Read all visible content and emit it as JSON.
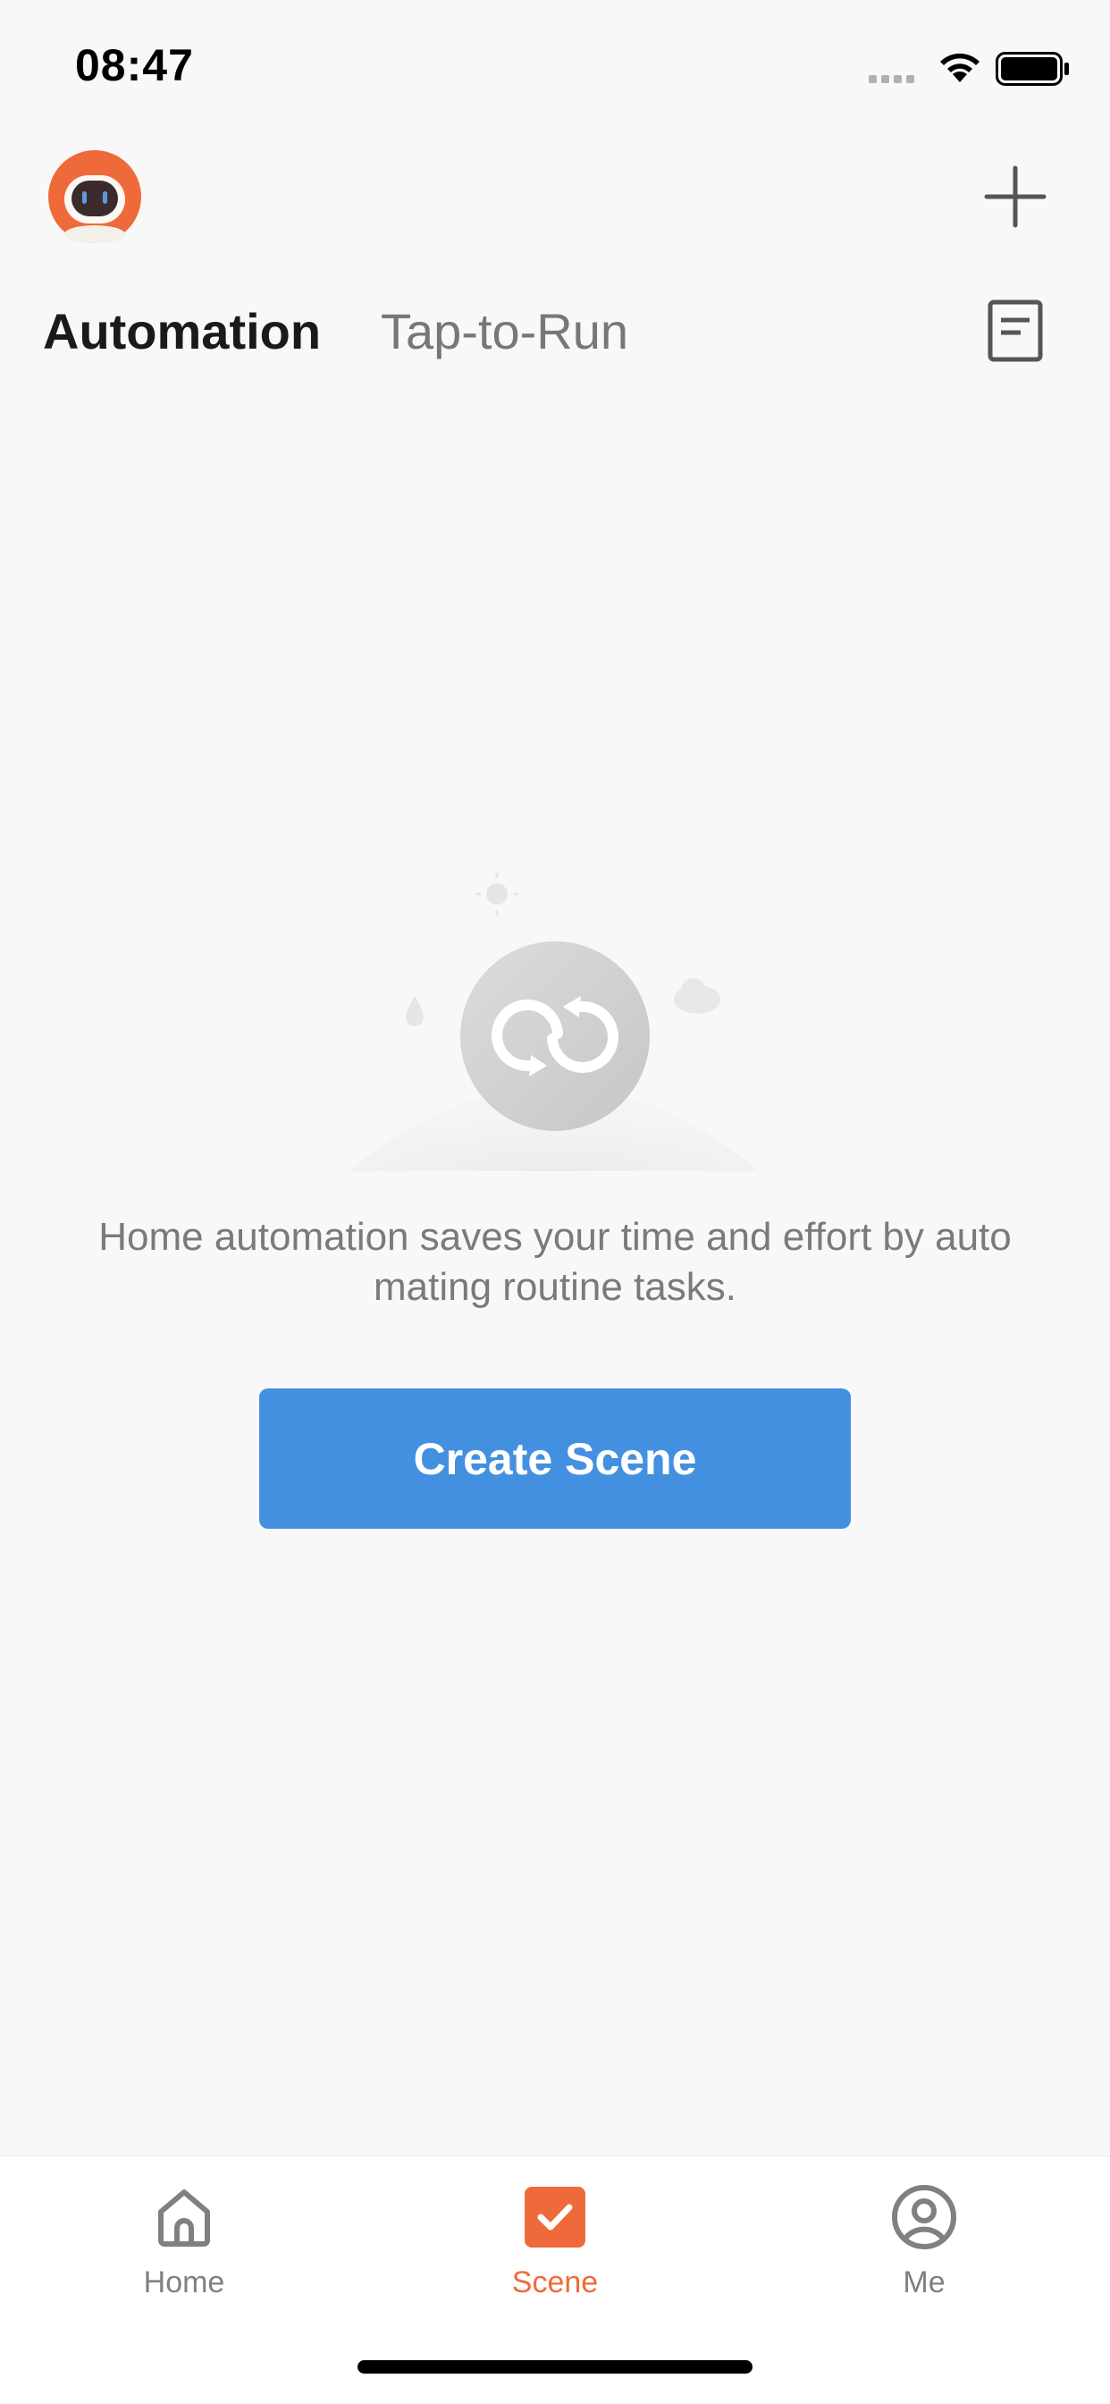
{
  "status": {
    "time": "08:47"
  },
  "tabs": [
    {
      "label": "Automation",
      "active": true
    },
    {
      "label": "Tap-to-Run",
      "active": false
    }
  ],
  "empty_state": {
    "message": "Home automation saves your time and effort by automating routine tasks.",
    "line1": "Home automation saves your time and effort by auto",
    "line2": "mating routine tasks.",
    "illustration_icon": "automation-loop-icon"
  },
  "create_button": {
    "label": "Create Scene",
    "color": "#4490e0"
  },
  "bottom_nav": {
    "items": [
      {
        "label": "Home",
        "icon": "home-icon",
        "active": false
      },
      {
        "label": "Scene",
        "icon": "scene-check-icon",
        "active": true
      },
      {
        "label": "Me",
        "icon": "profile-icon",
        "active": false
      }
    ],
    "active_color": "#ef6a3a"
  },
  "header": {
    "avatar_icon": "robot-avatar-icon",
    "add_icon": "plus-icon",
    "log_icon": "log-document-icon"
  }
}
